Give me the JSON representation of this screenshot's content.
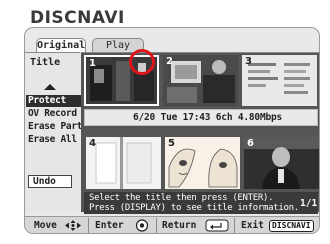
{
  "app": {
    "title": "DISCNAVI"
  },
  "tabs": [
    {
      "label": "Original",
      "active": true
    },
    {
      "label": "Play List",
      "active": false
    }
  ],
  "sidebar": {
    "heading": "Title",
    "items": [
      {
        "label": "Protect",
        "selected": true
      },
      {
        "label": "OV Record",
        "selected": false
      },
      {
        "label": "Erase Part",
        "selected": false
      },
      {
        "label": "Erase All",
        "selected": false
      }
    ],
    "undo_label": "Undo"
  },
  "thumbnails": [
    {
      "number": "1",
      "selected": true
    },
    {
      "number": "2",
      "selected": false
    },
    {
      "number": "3",
      "selected": false
    },
    {
      "number": "4",
      "selected": false
    },
    {
      "number": "5",
      "selected": false
    },
    {
      "number": "6",
      "selected": false
    }
  ],
  "info_bar": {
    "text": "6/20 Tue 17:43  6ch  4.80Mbps"
  },
  "message": {
    "line1": "Select the title then press (ENTER).",
    "line2": "Press (DISPLAY) to see title information."
  },
  "page_indicator": "1/1",
  "bottom_bar": {
    "move_label": "Move",
    "enter_label": "Enter",
    "return_label": "Return",
    "exit_label": "Exit",
    "exit_key": "DISCNAVI"
  },
  "colors": {
    "highlight_circle": "#e0141c",
    "selected_item_bg": "#2e2e2e",
    "content_bg": "#555555"
  }
}
